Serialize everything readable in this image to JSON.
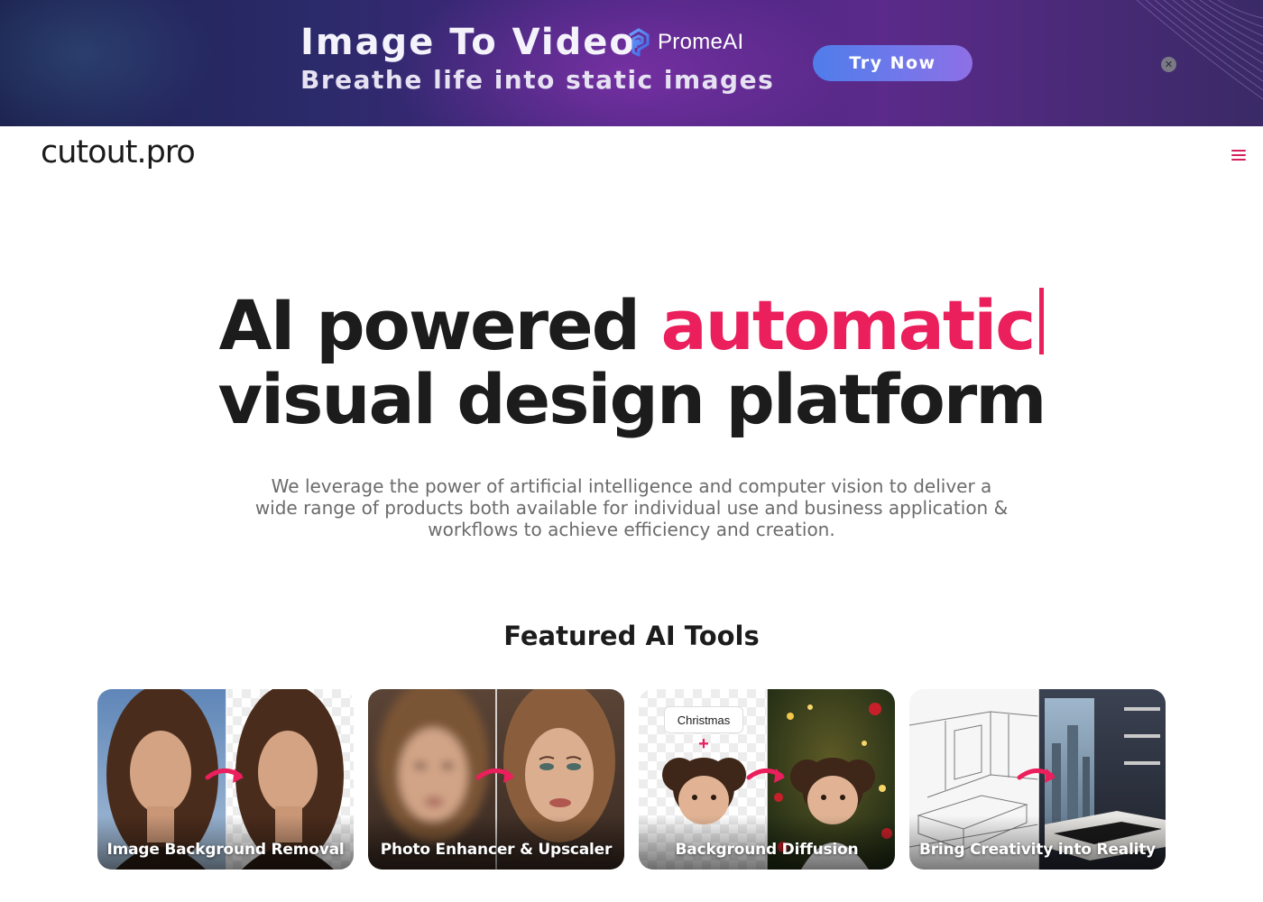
{
  "banner": {
    "title": "Image To Video",
    "subtitle": "Breathe life into static images",
    "brand": "PromeAI",
    "cta": "Try Now",
    "close_glyph": "✕"
  },
  "header": {
    "logo": "cutout.pro",
    "menu_icon": "hamburger-menu-icon"
  },
  "hero": {
    "line1_prefix": "AI powered ",
    "line1_accent": "automatic",
    "line2": "visual design platform",
    "description": "We leverage the power of artificial intelligence and computer vision to deliver a wide range of products both available for individual use and business application & workflows to achieve efficiency and creation."
  },
  "featured": {
    "title": "Featured AI Tools",
    "cards": [
      {
        "label": "Image Background Removal"
      },
      {
        "label": "Photo Enhancer & Upscaler"
      },
      {
        "label": "Background Diffusion",
        "tag": "Christmas",
        "tag_plus": "+"
      },
      {
        "label": "Bring Creativity into Reality"
      }
    ]
  },
  "colors": {
    "accent": "#ea1f5c",
    "text": "#1c1c1c",
    "muted": "#6b6b6b",
    "cta_start": "#4f7dea",
    "cta_end": "#8e6fe6"
  }
}
